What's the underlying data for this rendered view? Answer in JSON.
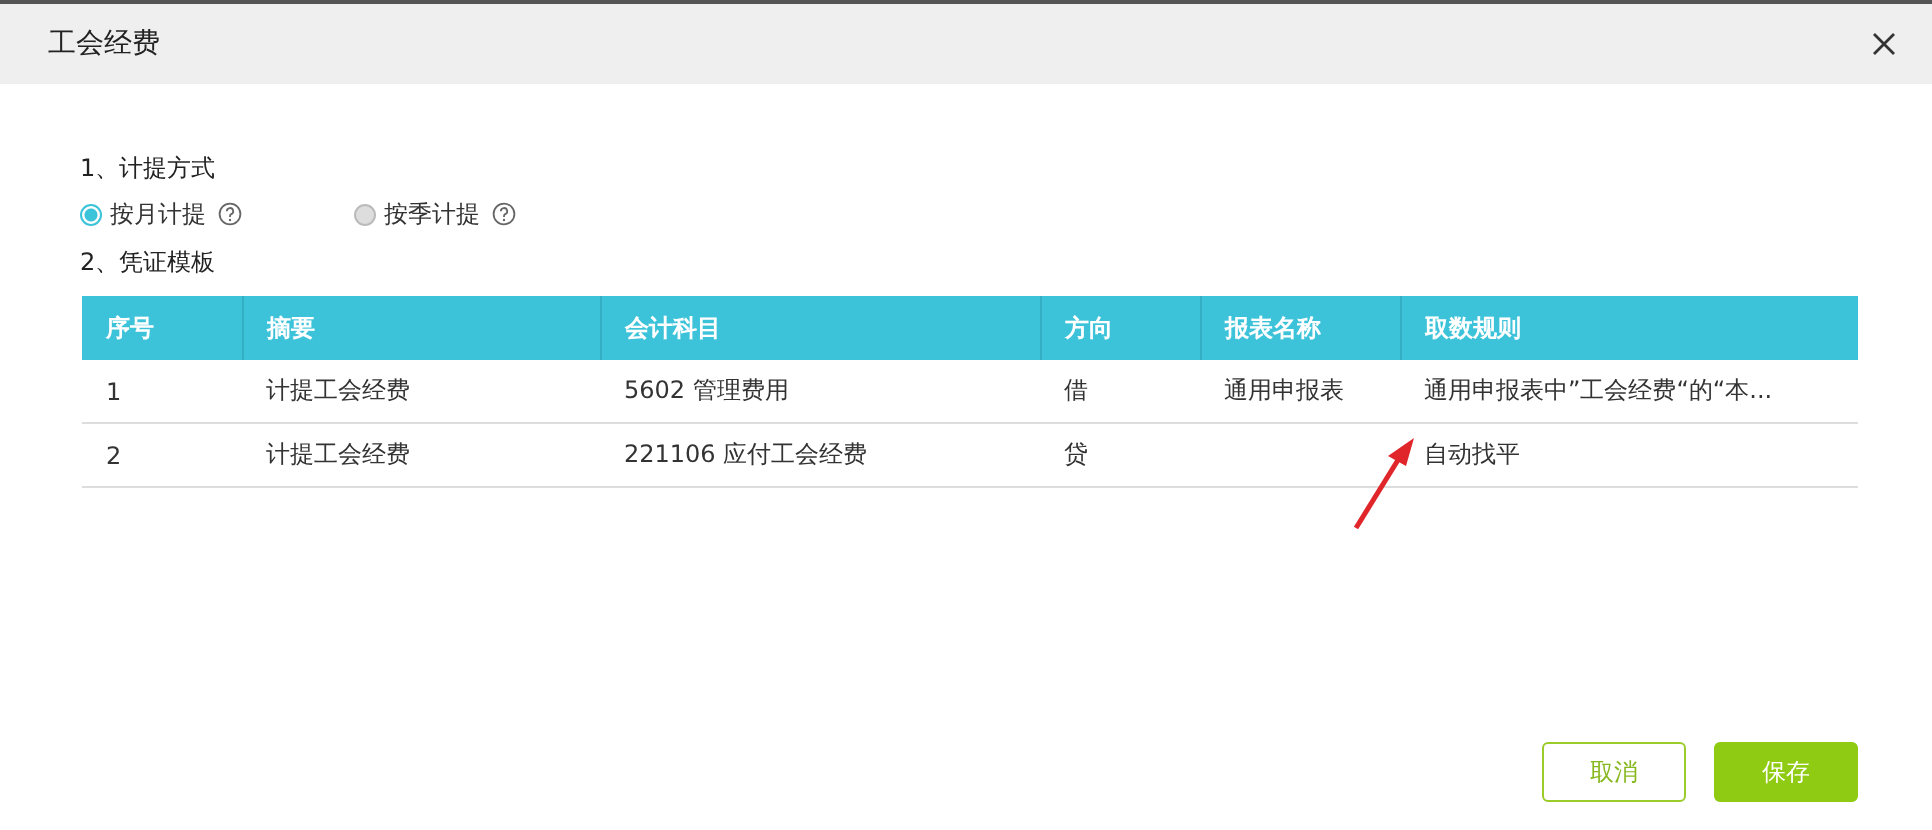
{
  "window": {
    "title": "工会经费"
  },
  "sections": [
    {
      "title": "1、计提方式"
    },
    {
      "title": "2、凭证模板"
    }
  ],
  "options": [
    {
      "label": "按月计提",
      "selected": true
    },
    {
      "label": "按季计提",
      "selected": false
    }
  ],
  "table": {
    "columns": [
      "序号",
      "摘要",
      "会计科目",
      "方向",
      "报表名称",
      "取数规则"
    ],
    "rows": [
      [
        "1",
        "计提工会经费",
        "5602 管理费用",
        "借",
        "通用申报表",
        "通用申报表中”工会经费“的“本..."
      ],
      [
        "2",
        "计提工会经费",
        "221106 应付工会经费",
        "贷",
        "",
        "自动找平"
      ]
    ]
  },
  "buttons": [
    {
      "label": "取消",
      "kind": "secondary"
    },
    {
      "label": "保存",
      "kind": "primary"
    }
  ]
}
